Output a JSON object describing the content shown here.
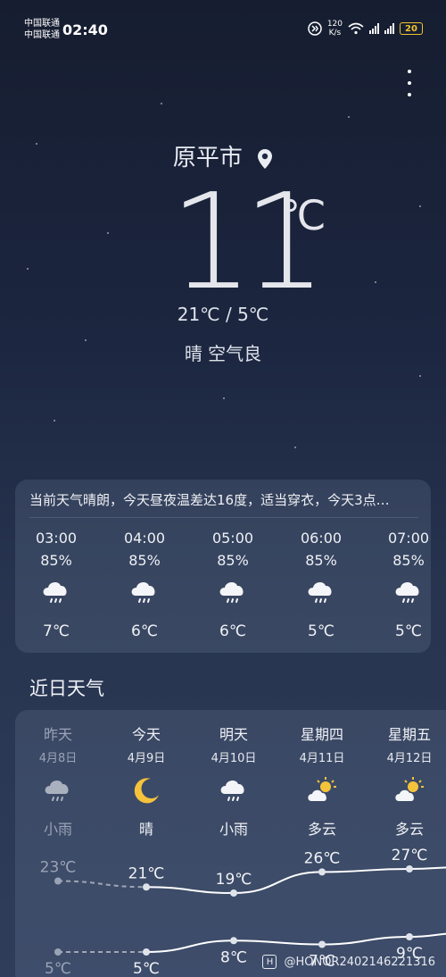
{
  "status_bar": {
    "carrier1": "中国联通",
    "carrier2": "中国联通",
    "time": "02:40",
    "net_speed": "120",
    "net_unit": "K/s",
    "battery": "20",
    "battery_color": "#f2c230"
  },
  "header": {
    "city": "原平市",
    "temperature": "11",
    "unit": "℃",
    "range": "21℃ / 5℃",
    "condition": "晴  空气良"
  },
  "hourly": {
    "summary": "当前天气晴朗，今天昼夜温差达16度，适当穿衣，今天3点…",
    "items": [
      {
        "time": "03:00",
        "precip": "85%",
        "icon": "rain-cloud-icon",
        "temp": "7℃"
      },
      {
        "time": "04:00",
        "precip": "85%",
        "icon": "rain-cloud-icon",
        "temp": "6℃"
      },
      {
        "time": "05:00",
        "precip": "85%",
        "icon": "rain-cloud-icon",
        "temp": "6℃"
      },
      {
        "time": "06:00",
        "precip": "85%",
        "icon": "rain-cloud-icon",
        "temp": "5℃"
      },
      {
        "time": "07:00",
        "precip": "85%",
        "icon": "rain-cloud-icon",
        "temp": "5℃"
      }
    ]
  },
  "daily": {
    "title": "近日天气",
    "days": [
      {
        "name": "昨天",
        "date": "4月8日",
        "icon": "rain-cloud-icon",
        "cond": "小雨",
        "high": "23℃",
        "low": "5℃",
        "high_val": 23,
        "low_val": 5
      },
      {
        "name": "今天",
        "date": "4月9日",
        "icon": "moon-icon",
        "cond": "晴",
        "high": "21℃",
        "low": "5℃",
        "high_val": 21,
        "low_val": 5
      },
      {
        "name": "明天",
        "date": "4月10日",
        "icon": "rain-cloud-icon",
        "cond": "小雨",
        "high": "19℃",
        "low": "8℃",
        "high_val": 19,
        "low_val": 8
      },
      {
        "name": "星期四",
        "date": "4月11日",
        "icon": "partly-cloudy-icon",
        "cond": "多云",
        "high": "26℃",
        "low": "7℃",
        "high_val": 26,
        "low_val": 7
      },
      {
        "name": "星期五",
        "date": "4月12日",
        "icon": "partly-cloudy-icon",
        "cond": "多云",
        "high": "27℃",
        "low": "9℃",
        "high_val": 27,
        "low_val": 9
      }
    ]
  },
  "watermark": {
    "badge": "H",
    "text": "@HONOR2402146221316"
  }
}
